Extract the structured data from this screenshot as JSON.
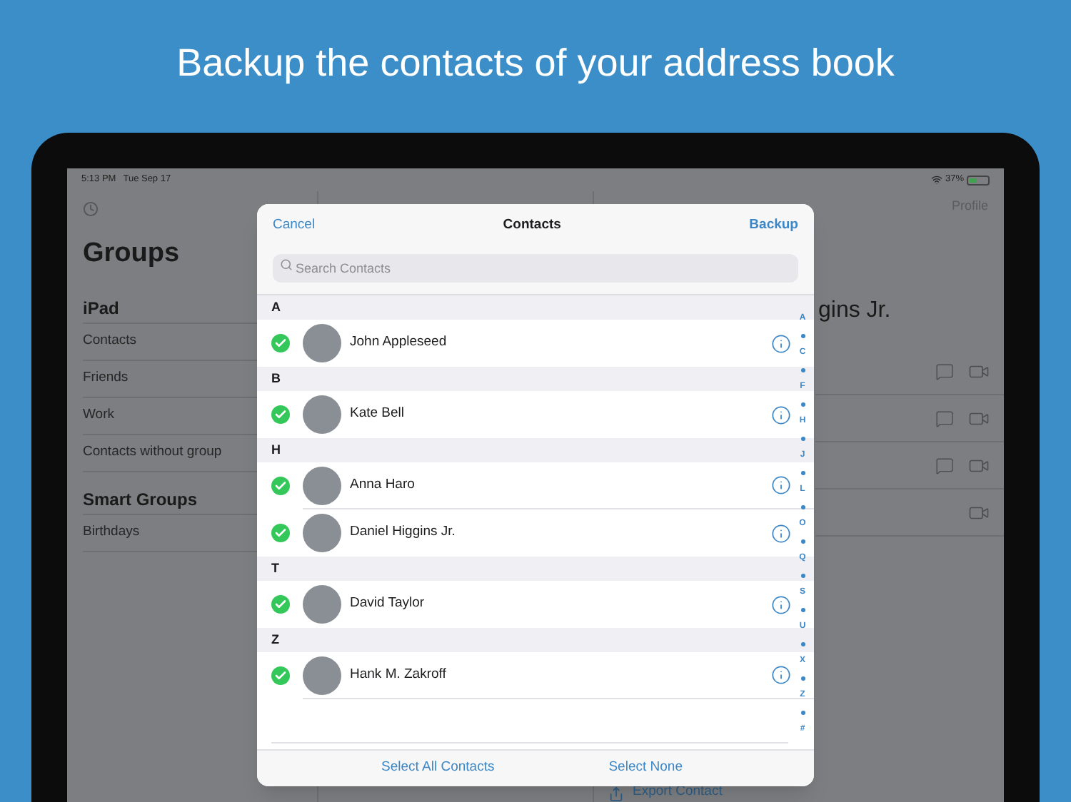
{
  "headline": "Backup the contacts of your address book",
  "status_bar": {
    "time": "5:13 PM",
    "date": "Tue Sep 17",
    "battery": "37%"
  },
  "sidebar": {
    "title": "Groups",
    "sections": [
      {
        "title": "iPad",
        "items": [
          "Contacts",
          "Friends",
          "Work",
          "Contacts without group"
        ]
      },
      {
        "title": "Smart Groups",
        "items": [
          "Birthdays"
        ]
      }
    ]
  },
  "detail": {
    "profile_link": "Profile",
    "name": "gins Jr.",
    "rows": [
      {
        "kind": "message_video"
      },
      {
        "kind": "message_video"
      },
      {
        "kind": "message_video"
      },
      {
        "kind": "video"
      }
    ],
    "export": "Export Contact"
  },
  "modal": {
    "cancel": "Cancel",
    "title": "Contacts",
    "backup": "Backup",
    "search": {
      "placeholder": "Search Contacts"
    },
    "sections": [
      {
        "letter": "A",
        "contacts": [
          {
            "name": "John Appleseed",
            "selected": true
          }
        ]
      },
      {
        "letter": "B",
        "contacts": [
          {
            "name": "Kate Bell",
            "selected": true
          }
        ]
      },
      {
        "letter": "H",
        "contacts": [
          {
            "name": "Anna Haro",
            "selected": true
          },
          {
            "name": "Daniel Higgins Jr.",
            "selected": true
          }
        ]
      },
      {
        "letter": "T",
        "contacts": [
          {
            "name": "David Taylor",
            "selected": true
          }
        ]
      },
      {
        "letter": "Z",
        "contacts": [
          {
            "name": "Hank M. Zakroff",
            "selected": true
          }
        ]
      }
    ],
    "index": [
      "A",
      "C",
      "F",
      "H",
      "J",
      "L",
      "O",
      "Q",
      "S",
      "U",
      "X",
      "Z",
      "#"
    ],
    "footer": [
      "Select All Contacts",
      "Select None"
    ]
  }
}
